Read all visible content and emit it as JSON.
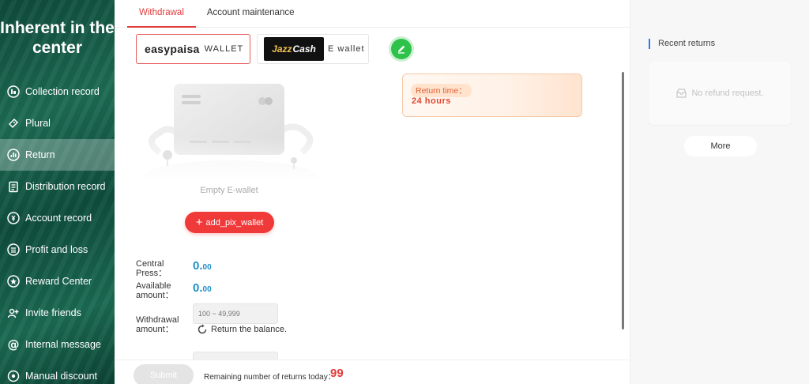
{
  "sidebar": {
    "brand": "Inherent in the center",
    "items": [
      {
        "label": "Collection record",
        "icon": "collection-icon"
      },
      {
        "label": "Plural",
        "icon": "ticket-icon"
      },
      {
        "label": "Return",
        "icon": "bar-chart-icon",
        "active": true
      },
      {
        "label": "Distribution record",
        "icon": "clipboard-icon"
      },
      {
        "label": "Account record",
        "icon": "coin-icon"
      },
      {
        "label": "Profit and loss",
        "icon": "list-icon"
      },
      {
        "label": "Reward Center",
        "icon": "gift-icon"
      },
      {
        "label": "Invite friends",
        "icon": "users-icon"
      },
      {
        "label": "Internal message",
        "icon": "at-icon"
      },
      {
        "label": "Manual discount",
        "icon": "gear-icon"
      }
    ]
  },
  "tabs": [
    {
      "label": "Withdrawal",
      "active": true
    },
    {
      "label": "Account maintenance",
      "active": false
    }
  ],
  "wallets": {
    "easypaisa": {
      "logo": "easypaisa",
      "suffix": "WALLET"
    },
    "jazzcash": {
      "logo_jazz": "Jazz",
      "logo_cash": "Cash",
      "suffix": "E wallet"
    }
  },
  "return_time": {
    "label": "Return time：",
    "value": "24 hours"
  },
  "empty": {
    "text": "Empty E-wallet",
    "add_button": "add_pix_wallet"
  },
  "fields": {
    "central_press_label": "Central Press：",
    "central_press_int": "0.",
    "central_press_dec": "00",
    "available_label": "Available amount：",
    "available_int": "0.",
    "available_dec": "00",
    "withdrawal_label": "Withdrawal amount：",
    "withdrawal_placeholder": "100 ~ 49,999",
    "return_balance": "Return the balance."
  },
  "footer": {
    "submit": "Submit",
    "remaining_label": "Remaining number of returns today：",
    "remaining_count": "99"
  },
  "right_panel": {
    "title": "Recent returns",
    "empty_text": "No refund request.",
    "more": "More"
  },
  "colors": {
    "accent": "#e33b3b",
    "amount_blue": "#1e8fc9",
    "edit_green": "#2fc24a",
    "sidebar_green": "#1d6b53"
  }
}
